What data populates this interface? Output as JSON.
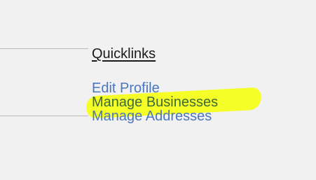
{
  "quicklinks": {
    "heading": "Quicklinks",
    "links": [
      {
        "label": "Edit Profile",
        "highlighted": false
      },
      {
        "label": "Manage Businesses",
        "highlighted": true
      },
      {
        "label": "Manage Addresses",
        "highlighted": false
      }
    ]
  },
  "colors": {
    "background": "#f1f1f1",
    "link": "#4a76c0",
    "highlight": "#f4ff1b",
    "divider": "#b9b9b9"
  }
}
